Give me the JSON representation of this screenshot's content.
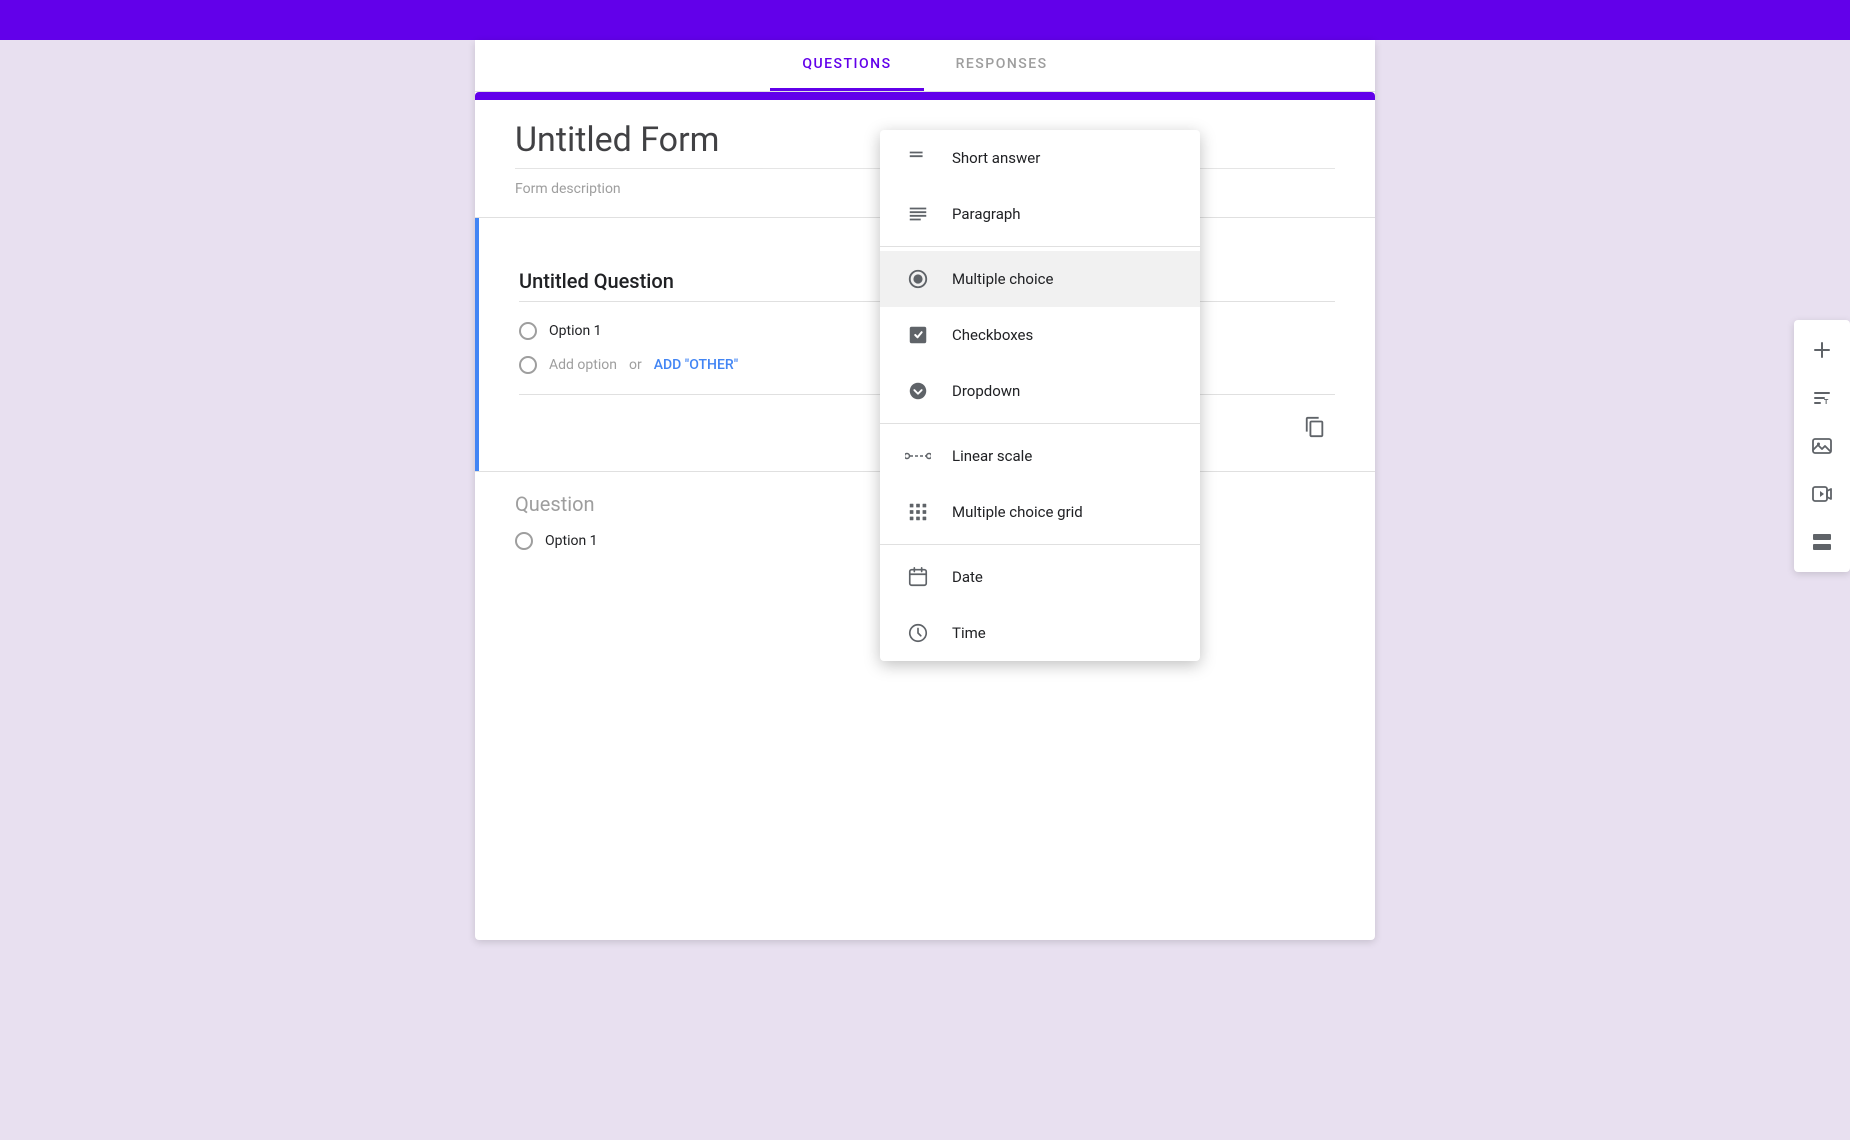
{
  "topBar": {
    "color": "#6200ea"
  },
  "tabs": {
    "questions": "QUESTIONS",
    "responses": "RESPONSES",
    "activeTab": "questions"
  },
  "form": {
    "title": "Untitled Form",
    "description": "Form description"
  },
  "activeQuestion": {
    "dragHandleText": "⠿⠿",
    "title": "Untitled Question",
    "option1": "Option 1",
    "addOptionText": "Add option",
    "addOptionOr": "or",
    "addOtherLink": "ADD \"OTHER\""
  },
  "inactiveQuestion": {
    "title": "Question",
    "option1": "Option 1"
  },
  "dropdown": {
    "items": [
      {
        "id": "short-answer",
        "label": "Short answer",
        "icon": "short-answer-icon"
      },
      {
        "id": "paragraph",
        "label": "Paragraph",
        "icon": "paragraph-icon"
      },
      {
        "id": "multiple-choice",
        "label": "Multiple choice",
        "icon": "multiple-choice-icon",
        "selected": true
      },
      {
        "id": "checkboxes",
        "label": "Checkboxes",
        "icon": "checkboxes-icon"
      },
      {
        "id": "dropdown",
        "label": "Dropdown",
        "icon": "dropdown-icon"
      },
      {
        "id": "linear-scale",
        "label": "Linear scale",
        "icon": "linear-scale-icon"
      },
      {
        "id": "multiple-choice-grid",
        "label": "Multiple choice grid",
        "icon": "multiple-choice-grid-icon"
      },
      {
        "id": "date",
        "label": "Date",
        "icon": "date-icon"
      },
      {
        "id": "time",
        "label": "Time",
        "icon": "time-icon"
      }
    ]
  },
  "sidebar": {
    "buttons": [
      {
        "id": "add",
        "icon": "plus-icon",
        "label": "Add question"
      },
      {
        "id": "title",
        "icon": "title-icon",
        "label": "Add title"
      },
      {
        "id": "image",
        "icon": "image-icon",
        "label": "Add image"
      },
      {
        "id": "video",
        "icon": "video-icon",
        "label": "Add video"
      },
      {
        "id": "section",
        "icon": "section-icon",
        "label": "Add section"
      }
    ]
  }
}
